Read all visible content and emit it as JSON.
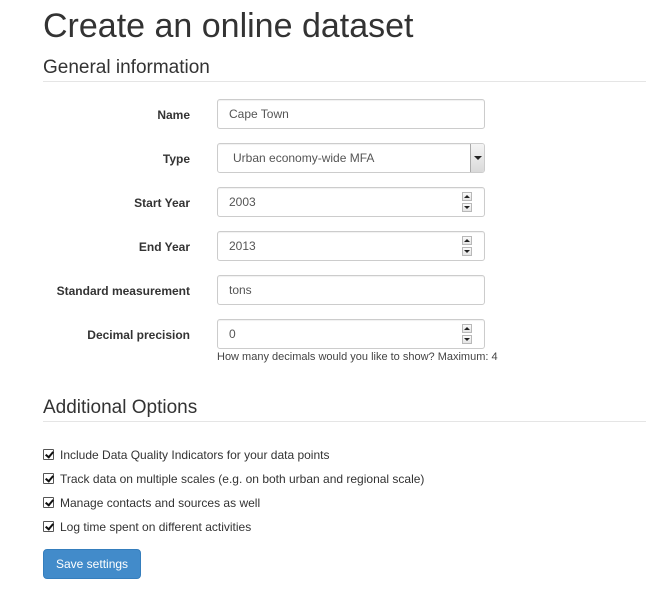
{
  "page_title": "Create an online dataset",
  "sections": {
    "general": "General information",
    "additional": "Additional Options"
  },
  "form": {
    "name": {
      "label": "Name",
      "value": "Cape Town"
    },
    "type": {
      "label": "Type",
      "selected": "Urban economy-wide MFA"
    },
    "start_year": {
      "label": "Start Year",
      "value": "2003"
    },
    "end_year": {
      "label": "End Year",
      "value": "2013"
    },
    "standard_measurement": {
      "label": "Standard measurement",
      "value": "tons"
    },
    "decimal_precision": {
      "label": "Decimal precision",
      "value": "0",
      "help": "How many decimals would you like to show? Maximum: 4"
    }
  },
  "options": [
    {
      "label": "Include Data Quality Indicators for your data points",
      "checked": true
    },
    {
      "label": "Track data on multiple scales (e.g. on both urban and regional scale)",
      "checked": true
    },
    {
      "label": "Manage contacts and sources as well",
      "checked": true
    },
    {
      "label": "Log time spent on different activities",
      "checked": true
    }
  ],
  "save_label": "Save settings"
}
